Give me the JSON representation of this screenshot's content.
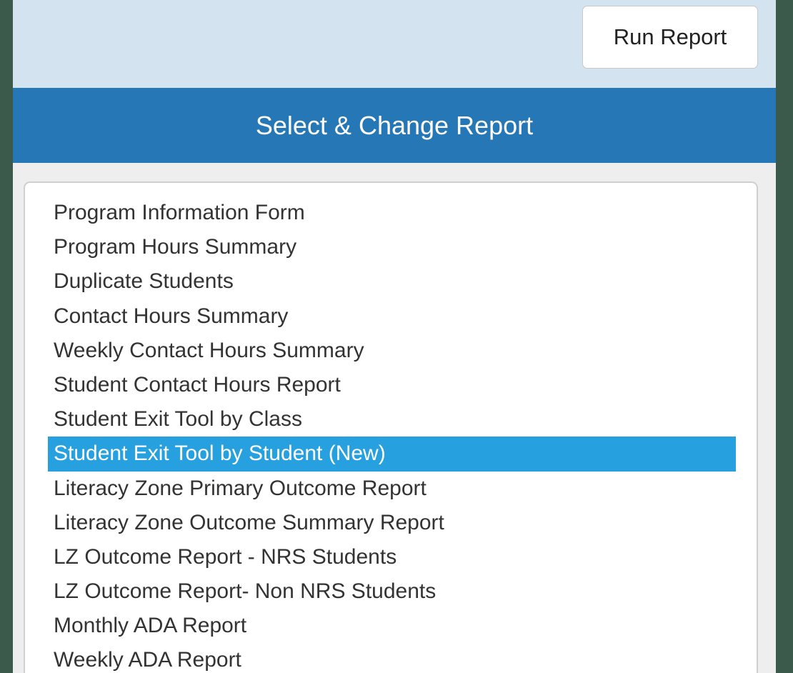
{
  "toolbar": {
    "run_label": "Run Report"
  },
  "panel": {
    "title": "Select & Change Report"
  },
  "reports": {
    "selected_index": 7,
    "items": [
      "Program Information Form",
      "Program Hours Summary",
      "Duplicate Students",
      "Contact Hours Summary",
      "Weekly Contact Hours Summary",
      "Student Contact Hours Report",
      "Student Exit Tool by Class",
      "Student Exit Tool by Student (New)",
      "Literacy Zone Primary Outcome Report",
      "Literacy Zone Outcome Summary Report",
      "LZ Outcome Report - NRS Students",
      "LZ Outcome Report- Non NRS Students",
      "Monthly ADA Report",
      "Weekly ADA Report"
    ]
  },
  "colors": {
    "header_bg": "#2577b5",
    "selected_bg": "#27a0df",
    "toolbar_bg": "#d3e3ef",
    "outer_bg": "#3b5a4c"
  }
}
